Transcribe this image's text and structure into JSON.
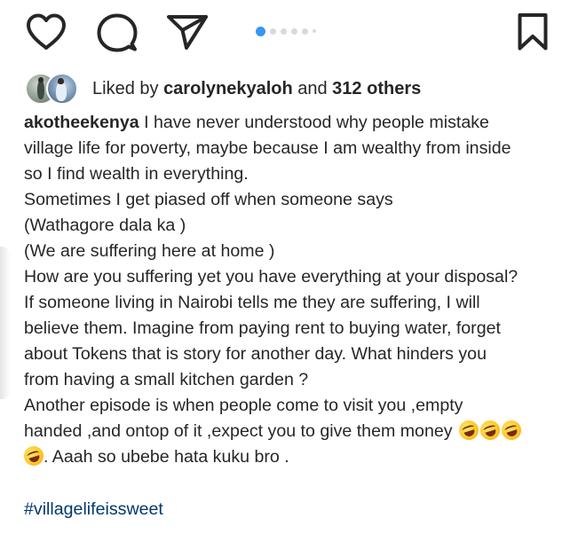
{
  "post": {
    "carousel": {
      "total_dots": 6,
      "active_index": 0
    },
    "likes": {
      "prefix": "Liked by ",
      "user": "carolynekyaloh",
      "middle": " and ",
      "others": "312 others"
    },
    "caption": {
      "username": "akotheekenya",
      "lines": [
        "I have never understood why people mistake",
        "village life for poverty,  maybe because I am wealthy from inside",
        "so I find wealth in everything.",
        "Sometimes I get piased off when someone says",
        "(Wathagore dala ka )",
        "(We are suffering here at home )",
        "How are you suffering yet you have everything at your disposal?",
        "If someone living in Nairobi tells me they are suffering, I will",
        "believe them.  Imagine from paying rent to buying water, forget",
        "about Tokens that is story for another day. What hinders you",
        "from having a small kitchen garden ?",
        "Another episode is when people come to visit you ,empty",
        "handed ,and ontop of it ,expect you to give them money",
        ". Aaah so ubebe hata kuku bro ."
      ],
      "emoji_name": "rolling-on-the-floor-laughing"
    },
    "hashtag": "#villagelifeissweet"
  },
  "icons": {
    "like": "heart-icon",
    "comment": "comment-bubble-icon",
    "share": "paper-plane-icon",
    "save": "bookmark-icon"
  },
  "colors": {
    "text": "#262626",
    "link": "#00376b",
    "active_dot": "#3897f0",
    "inactive_dot": "#d9d9d9"
  }
}
